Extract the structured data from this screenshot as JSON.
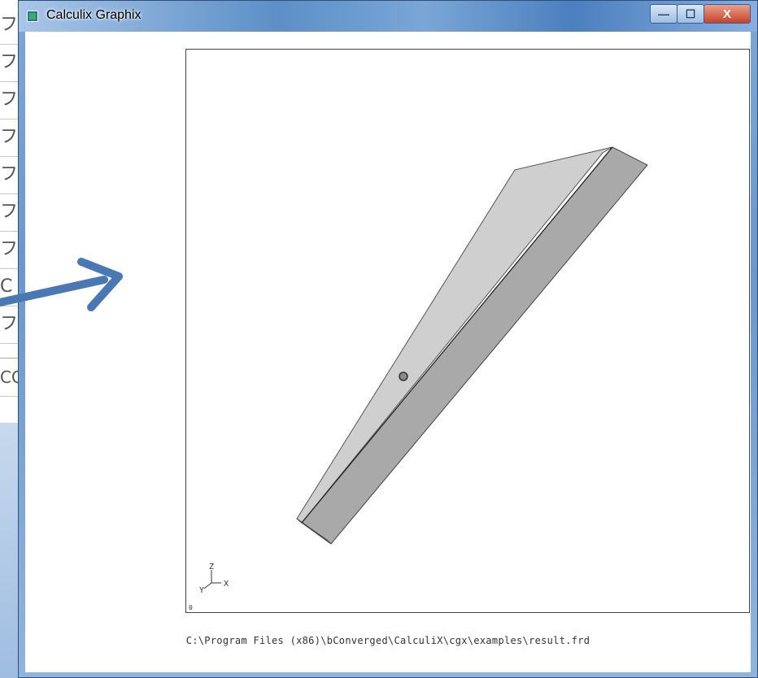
{
  "background_window": {
    "rows": [
      "フ",
      "フ",
      "フ",
      "フ",
      "フ",
      "フ",
      "フ",
      "C",
      "フ",
      "CC"
    ]
  },
  "window": {
    "title": "Calculix Graphix",
    "buttons": {
      "minimize": "—",
      "maximize": "☐",
      "close": "X"
    }
  },
  "viewport": {
    "axes": {
      "z": "Z",
      "y": "Y",
      "x": "X"
    },
    "corner_label": "0"
  },
  "statusbar": {
    "file_path": "C:\\Program Files (x86)\\bConverged\\CalculiX\\cgx\\examples\\result.frd"
  },
  "colors": {
    "accent_arrow": "#4a78b4",
    "model_top": "#cfcfcf",
    "model_side": "#a9a9a9"
  }
}
